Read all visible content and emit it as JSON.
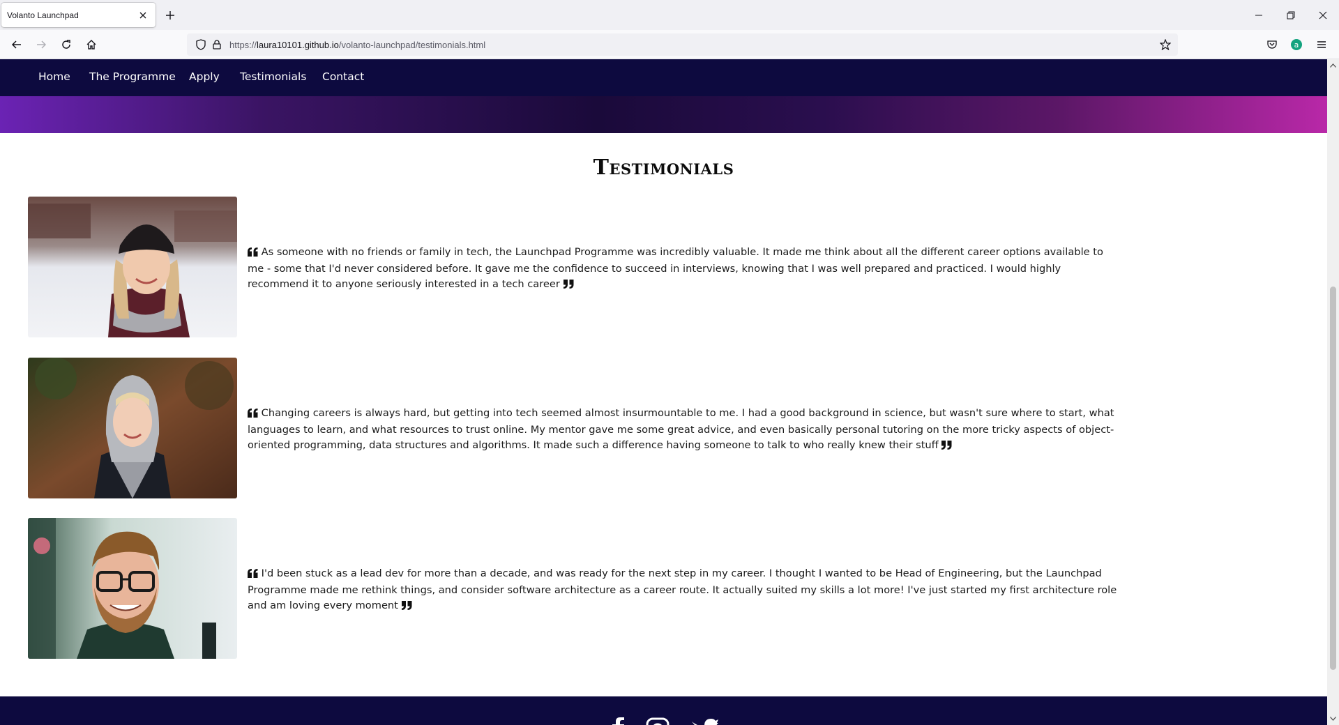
{
  "browser": {
    "tab_title": "Volanto Launchpad",
    "url_prefix": "https://",
    "url_host": "laura10101.github.io",
    "url_path": "/volanto-launchpad/testimonials.html"
  },
  "site_nav": {
    "items": [
      {
        "label": "Home"
      },
      {
        "label": "The Programme"
      },
      {
        "label": "Apply"
      },
      {
        "label": "Testimonials"
      },
      {
        "label": "Contact"
      }
    ]
  },
  "page": {
    "title": "Testimonials"
  },
  "testimonials": [
    {
      "text": "As someone with no friends or family in tech, the Launchpad Programme was incredibly valuable. It made me think about all the different career options available to me - some that I'd never considered before. It gave me the confidence to succeed in interviews, knowing that I was well prepared and practiced. I would highly recommend it to anyone seriously interested in a tech career",
      "photo": "woman-in-beanie-photo"
    },
    {
      "text": "Changing careers is always hard, but getting into tech seemed almost insurmountable to me. I had a good background in science, but wasn't sure where to start, what languages to learn, and what resources to trust online. My mentor gave me some great advice, and even basically personal tutoring on the more tricky aspects of object-oriented programming, data structures and algorithms. It made such a difference having someone to talk to who really knew their stuff",
      "photo": "woman-in-hoodie-photo"
    },
    {
      "text": "I'd been stuck as a lead dev for more than a decade, and was ready for the next step in my career. I thought I wanted to be Head of Engineering, but the Launchpad Programme made me rethink things, and consider software architecture as a career route. It actually suited my skills a lot more! I've just started my first architecture role and am loving every moment",
      "photo": "man-with-glasses-photo"
    }
  ],
  "footer": {
    "social_icons": [
      "facebook-icon",
      "instagram-icon",
      "twitter-icon"
    ]
  },
  "colors": {
    "nav_bg": "#0d0a3f",
    "gradient_left": "#6b23b4",
    "gradient_right": "#b928a8"
  }
}
